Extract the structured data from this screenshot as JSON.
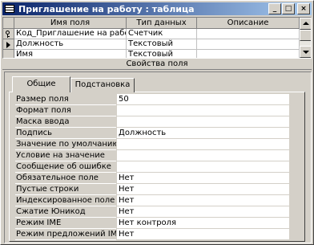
{
  "window": {
    "title": "Приглашение на работу : таблица"
  },
  "grid": {
    "columns": [
      "Имя поля",
      "Тип данных",
      "Описание"
    ],
    "rows": [
      {
        "name": "Код_Приглашение на работ",
        "type": "Счетчик",
        "description": "",
        "marker": "key"
      },
      {
        "name": "Должность",
        "type": "Текстовый",
        "description": "",
        "marker": "current"
      },
      {
        "name": "Имя",
        "type": "Текстовый",
        "description": "",
        "marker": ""
      }
    ]
  },
  "properties": {
    "caption": "Свойства поля",
    "tabs": [
      "Общие",
      "Подстановка"
    ],
    "active_tab": "Общие",
    "rows": [
      {
        "label": "Размер поля",
        "value": "50"
      },
      {
        "label": "Формат поля",
        "value": ""
      },
      {
        "label": "Маска ввода",
        "value": ""
      },
      {
        "label": "Подпись",
        "value": "Должность"
      },
      {
        "label": "Значение по умолчанию",
        "value": ""
      },
      {
        "label": "Условие на значение",
        "value": ""
      },
      {
        "label": "Сообщение об ошибке",
        "value": ""
      },
      {
        "label": "Обязательное поле",
        "value": "Нет"
      },
      {
        "label": "Пустые строки",
        "value": "Нет"
      },
      {
        "label": "Индексированное поле",
        "value": "Нет"
      },
      {
        "label": "Сжатие Юникод",
        "value": "Нет"
      },
      {
        "label": "Режим IME",
        "value": "Нет контроля"
      },
      {
        "label": "Режим предложений IME",
        "value": "Нет"
      }
    ]
  }
}
